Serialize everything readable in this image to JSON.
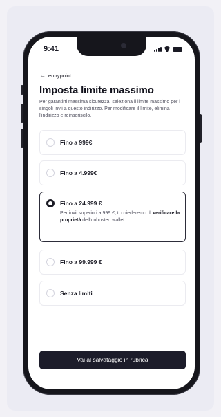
{
  "status_bar": {
    "time": "9:41"
  },
  "nav": {
    "back_label": "entrypoint",
    "back_icon": "arrow-left-icon"
  },
  "page": {
    "title": "Imposta limite massimo",
    "description": "Per garantirti massima sicurezza, seleziona il limite massimo per i singoli invii a questo indirizzo. Per modificare il limite, elimina l'indirizzo e reinseriscilo."
  },
  "options": [
    {
      "label": "Fino a 999€",
      "selected": false
    },
    {
      "label": "Fino a 4.999€",
      "selected": false
    },
    {
      "label": "Fino a 24.999 €",
      "selected": true,
      "note_before": "Per invii superiori a 999 €, ti chiederemo di ",
      "note_bold": "verificare la proprietà",
      "note_after": " dell'unhosted wallet"
    },
    {
      "label": "Fino a 99.999 €",
      "selected": false
    },
    {
      "label": "Senza limiti",
      "selected": false
    }
  ],
  "cta": {
    "label": "Vai al salvataggio in rubrica"
  },
  "colors": {
    "accent": "#1c1c2a",
    "background": "#f2f1f6",
    "border": "#ebebf0"
  }
}
